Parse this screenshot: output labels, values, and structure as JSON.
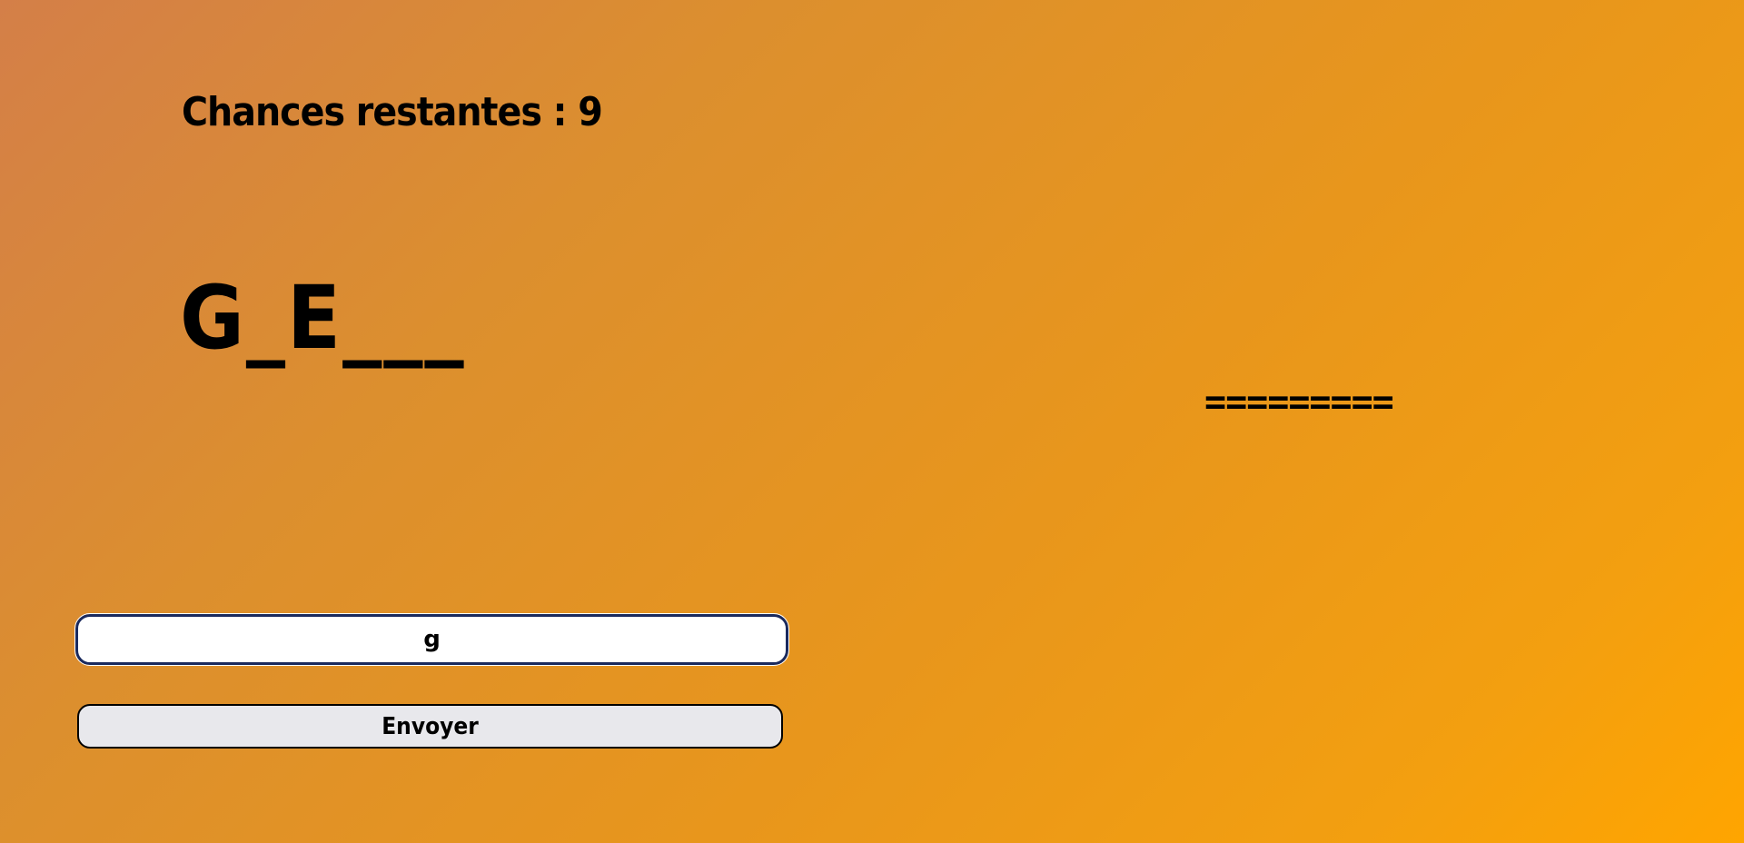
{
  "game": {
    "chances_text": "Chances restantes : 9",
    "masked_word": "G_E___",
    "gallows_art": "========="
  },
  "form": {
    "letter_value": "g",
    "send_label": "Envoyer"
  },
  "colors": {
    "background_start": "#d47f48",
    "background_end": "#ffa500",
    "input_border": "#1a2a5e",
    "button_bg": "#e8e8ec"
  }
}
